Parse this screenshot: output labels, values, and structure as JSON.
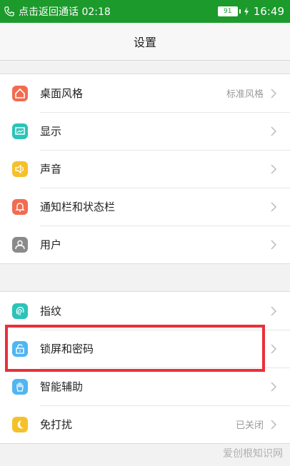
{
  "status_bar": {
    "call_text": "点击返回通话 02:18",
    "battery": "91",
    "time": "16:49"
  },
  "title": "设置",
  "groups": [
    {
      "items": [
        {
          "label": "桌面风格",
          "value": "标准风格",
          "icon": "desktop-icon",
          "color": "#f26b50"
        },
        {
          "label": "显示",
          "icon": "display-icon",
          "color": "#2cc3b8"
        },
        {
          "label": "声音",
          "icon": "sound-icon",
          "color": "#f5c02a"
        },
        {
          "label": "通知栏和状态栏",
          "icon": "bell-icon",
          "color": "#f26b50"
        },
        {
          "label": "用户",
          "icon": "user-icon",
          "color": "#8a8a8a"
        }
      ]
    },
    {
      "items": [
        {
          "label": "指纹",
          "icon": "fingerprint-icon",
          "color": "#2cc3b8"
        },
        {
          "label": "锁屏和密码",
          "icon": "lock-icon",
          "color": "#4fb6f2"
        },
        {
          "label": "智能辅助",
          "icon": "hand-icon",
          "color": "#4fb6f2"
        },
        {
          "label": "免打扰",
          "value": "已关闭",
          "icon": "moon-icon",
          "color": "#f5c02a"
        }
      ]
    }
  ],
  "watermark": "爱创根知识网",
  "colors": {
    "status_bar": "#1c9a2c",
    "highlight": "#e8303a"
  }
}
